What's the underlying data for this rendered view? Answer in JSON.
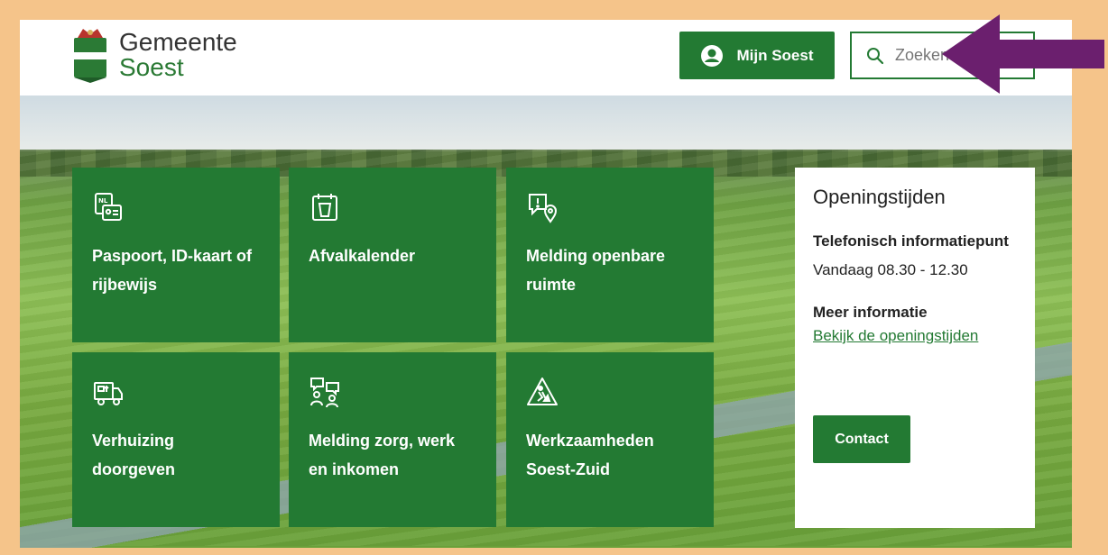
{
  "header": {
    "logo_line1": "Gemeente",
    "logo_line2": "Soest",
    "account_button": "Mijn Soest",
    "search_placeholder": "Zoeken"
  },
  "tiles": [
    {
      "label": "Paspoort, ID-kaart of rijbewijs",
      "icon": "id-card-icon"
    },
    {
      "label": "Afvalkalender",
      "icon": "waste-bin-calendar-icon"
    },
    {
      "label": "Melding openbare ruimte",
      "icon": "report-location-icon"
    },
    {
      "label": "Verhuizing doorgeven",
      "icon": "moving-truck-icon"
    },
    {
      "label": "Melding zorg, werk en inkomen",
      "icon": "people-chat-icon"
    },
    {
      "label": "Werkzaamheden Soest-Zuid",
      "icon": "road-works-icon"
    }
  ],
  "opening_hours": {
    "title": "Openingstijden",
    "subtitle": "Telefonisch informatiepunt",
    "today": "Vandaag 08.30 - 12.30",
    "more_label": "Meer informatie",
    "link": "Bekijk de openingstijden",
    "contact_button": "Contact"
  },
  "colors": {
    "primary_green": "#237a33",
    "frame_orange": "#f5c48a",
    "arrow_purple": "#6b1f6e"
  }
}
